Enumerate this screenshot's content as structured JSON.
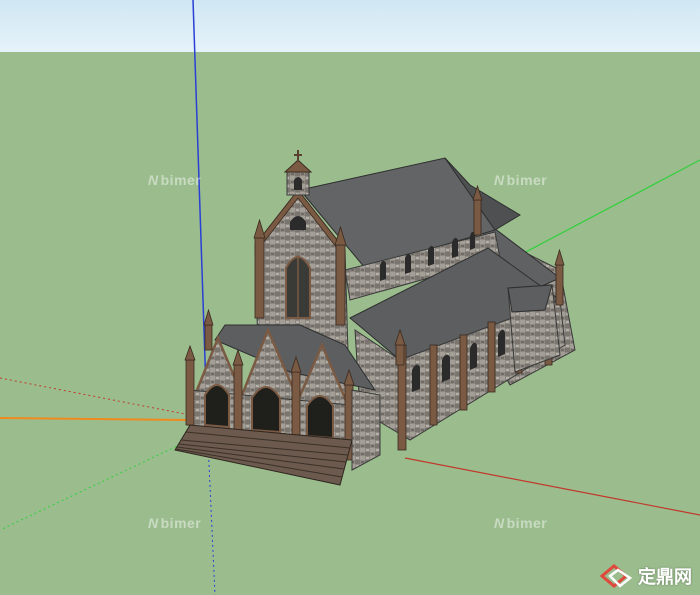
{
  "canvas": {
    "sky_color": "#d9edf7",
    "ground_color": "#9bbd8e"
  },
  "axes": {
    "blue": "#2a3fd6",
    "green": "#2fd03a",
    "red": "#c0392b",
    "orange": "#f08a1c"
  },
  "model": {
    "subject": "gothic church",
    "roof_color": "#5f6163",
    "stone_color": "#8c8880",
    "trim_color": "#7b5a44",
    "stairs_color": "#6b5a4d"
  },
  "watermarks": {
    "text": "bimer"
  },
  "brand": {
    "logo_icon": "diamond-logo-icon",
    "text": "定鼎网"
  }
}
